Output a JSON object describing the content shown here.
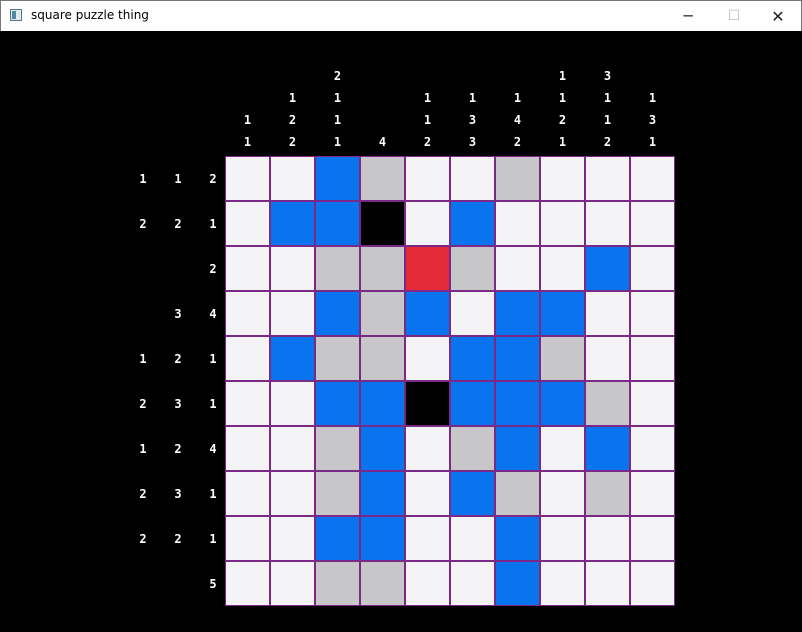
{
  "window": {
    "title": "square puzzle thing",
    "controls": {
      "minimize": "─",
      "maximize": "☐",
      "close": "✕"
    }
  },
  "puzzle": {
    "size": 10,
    "colors": {
      "empty": "#f4f3f6",
      "filled": "#0a74ef",
      "crossed": "#c7c6c9",
      "cursor": "#e22a38",
      "grid_line": "#7a2a86"
    },
    "column_clues": [
      [
        "1",
        "1"
      ],
      [
        "1",
        "2",
        "2"
      ],
      [
        "2",
        "1",
        "1",
        "1"
      ],
      [
        "4"
      ],
      [
        "1",
        "1",
        "2"
      ],
      [
        "1",
        "3",
        "3"
      ],
      [
        "1",
        "4",
        "2"
      ],
      [
        "1",
        "1",
        "2",
        "1"
      ],
      [
        "3",
        "1",
        "1",
        "2"
      ],
      [
        "1",
        "3",
        "1"
      ]
    ],
    "row_clues": [
      [
        "1",
        "1",
        "2"
      ],
      [
        "2",
        "2",
        "1"
      ],
      [
        "2"
      ],
      [
        "3",
        "4"
      ],
      [
        "1",
        "2",
        "1"
      ],
      [
        "2",
        "3",
        "1"
      ],
      [
        "1",
        "2",
        "4"
      ],
      [
        "2",
        "3",
        "1"
      ],
      [
        "2",
        "2",
        "1"
      ],
      [
        "5"
      ]
    ],
    "cells": [
      "eefxeexeee",
      "efftefeeee",
      "eexxcxeefe",
      "eefxfeffee",
      "efxxeffxee",
      "eefftfffxe",
      "eexfexfefe",
      "eexfefxexe",
      "eeffeefeee",
      "eexxeefeee"
    ]
  }
}
